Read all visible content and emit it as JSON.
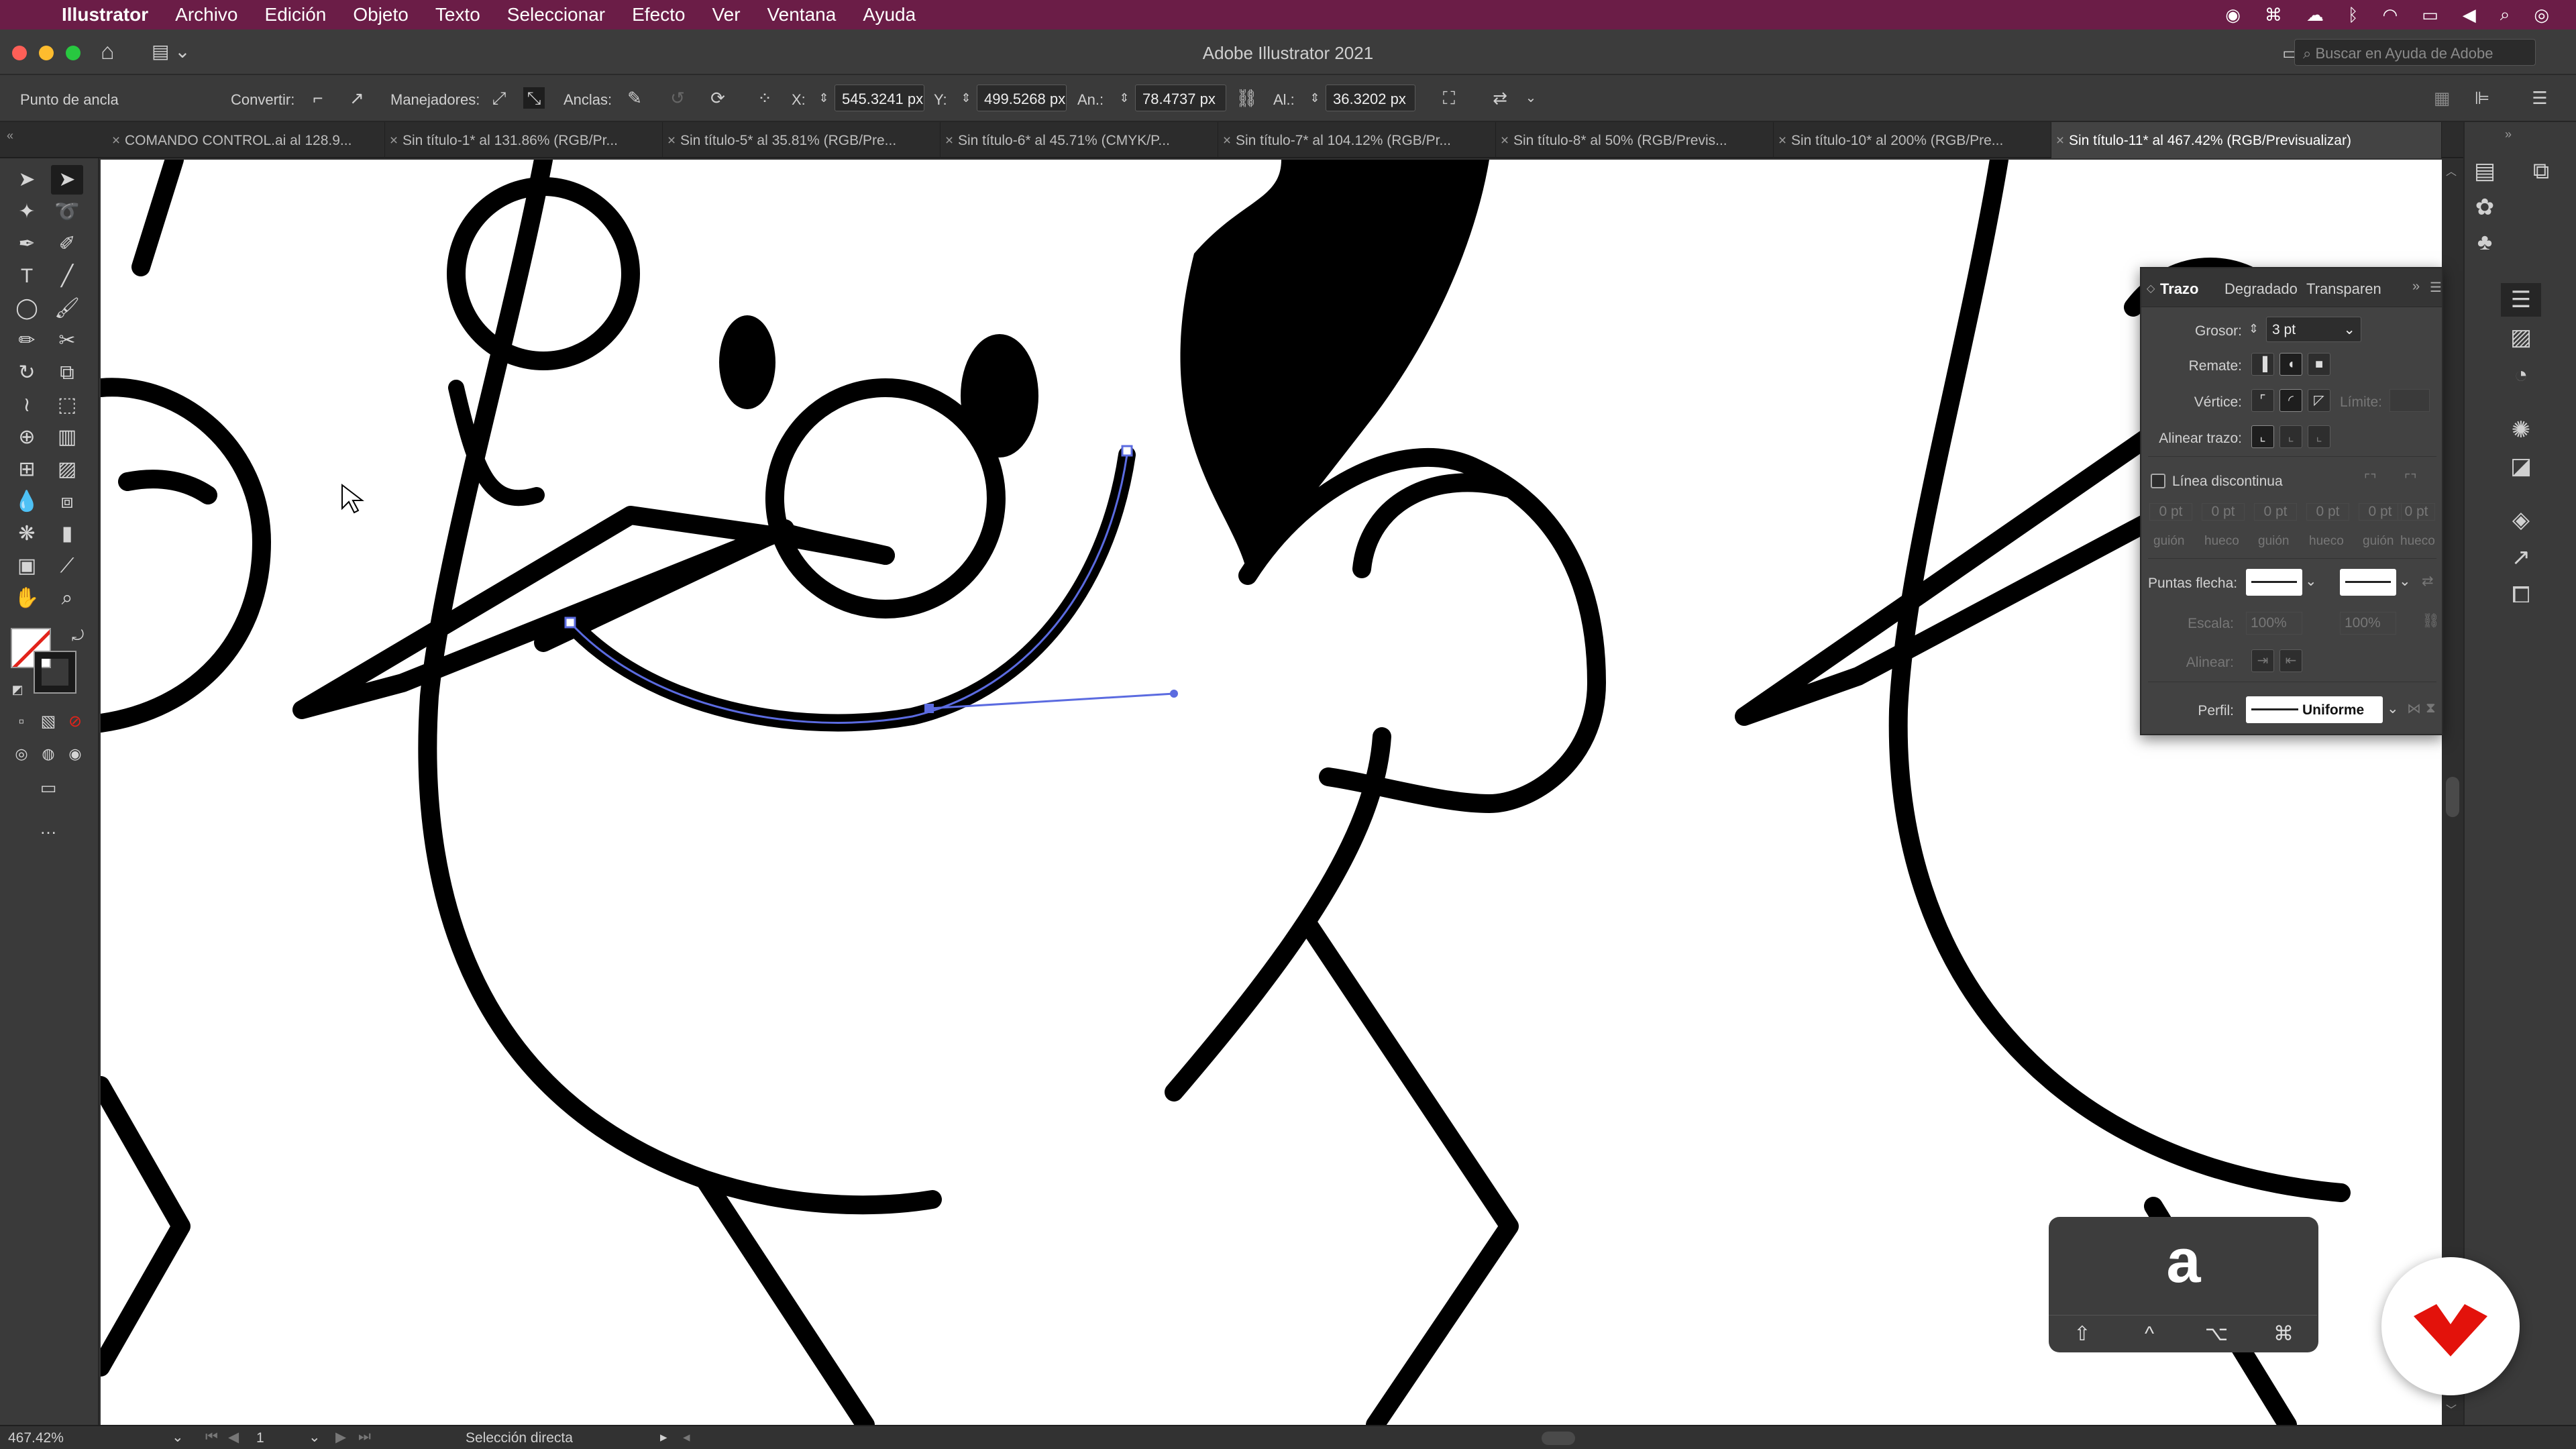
{
  "menubar": {
    "apple": "",
    "app": "Illustrator",
    "items": [
      "Archivo",
      "Edición",
      "Objeto",
      "Texto",
      "Seleccionar",
      "Efecto",
      "Ver",
      "Ventana",
      "Ayuda"
    ]
  },
  "window": {
    "title": "Adobe Illustrator 2021",
    "search_placeholder": "Buscar en Ayuda de Adobe"
  },
  "control": {
    "selection_label": "Punto de ancla",
    "convert_label": "Convertir:",
    "handles_label": "Manejadores:",
    "anchors_label": "Anclas:",
    "x_label": "X:",
    "x_value": "545.3241 px",
    "y_label": "Y:",
    "y_value": "499.5268 px",
    "w_label": "An.:",
    "w_value": "78.4737 px",
    "h_label": "Al.:",
    "h_value": "36.3202 px"
  },
  "tabs": [
    {
      "label": "COMANDO CONTROL.ai al 128.9..."
    },
    {
      "label": "Sin título-1* al 131.86% (RGB/Pr..."
    },
    {
      "label": "Sin título-5* al 35.81% (RGB/Pre..."
    },
    {
      "label": "Sin título-6* al 45.71% (CMYK/P..."
    },
    {
      "label": "Sin título-7* al 104.12% (RGB/Pr..."
    },
    {
      "label": "Sin título-8* al 50% (RGB/Previs..."
    },
    {
      "label": "Sin título-10* al 200% (RGB/Pre..."
    },
    {
      "label": "Sin título-11* al 467.42% (RGB/Previsualizar)"
    }
  ],
  "stroke_panel": {
    "tab_stroke": "Trazo",
    "tab_gradient": "Degradado",
    "tab_transparency": "Transparencia",
    "weight_label": "Grosor:",
    "weight_value": "3 pt",
    "cap_label": "Remate:",
    "corner_label": "Vértice:",
    "limit_label": "Límite:",
    "align_label": "Alinear trazo:",
    "dashed_label": "Línea discontinua",
    "dash_cols": [
      "guión",
      "hueco",
      "guión",
      "hueco",
      "guión",
      "hueco"
    ],
    "dash_values": [
      "0 pt",
      "0 pt",
      "0 pt",
      "0 pt",
      "0 pt",
      "0 pt"
    ],
    "arrowheads_label": "Puntas flecha:",
    "scale_label": "Escala:",
    "scale_values": [
      "100%",
      "100%"
    ],
    "align_arrow_label": "Alinear:",
    "profile_label": "Perfil:",
    "profile_value": "Uniforme"
  },
  "status": {
    "zoom": "467.42%",
    "artboard": "1",
    "tool": "Selección directa"
  },
  "keycast": {
    "key": "a",
    "modifiers": [
      "⇧",
      "^",
      "⌥",
      "⌘"
    ]
  }
}
